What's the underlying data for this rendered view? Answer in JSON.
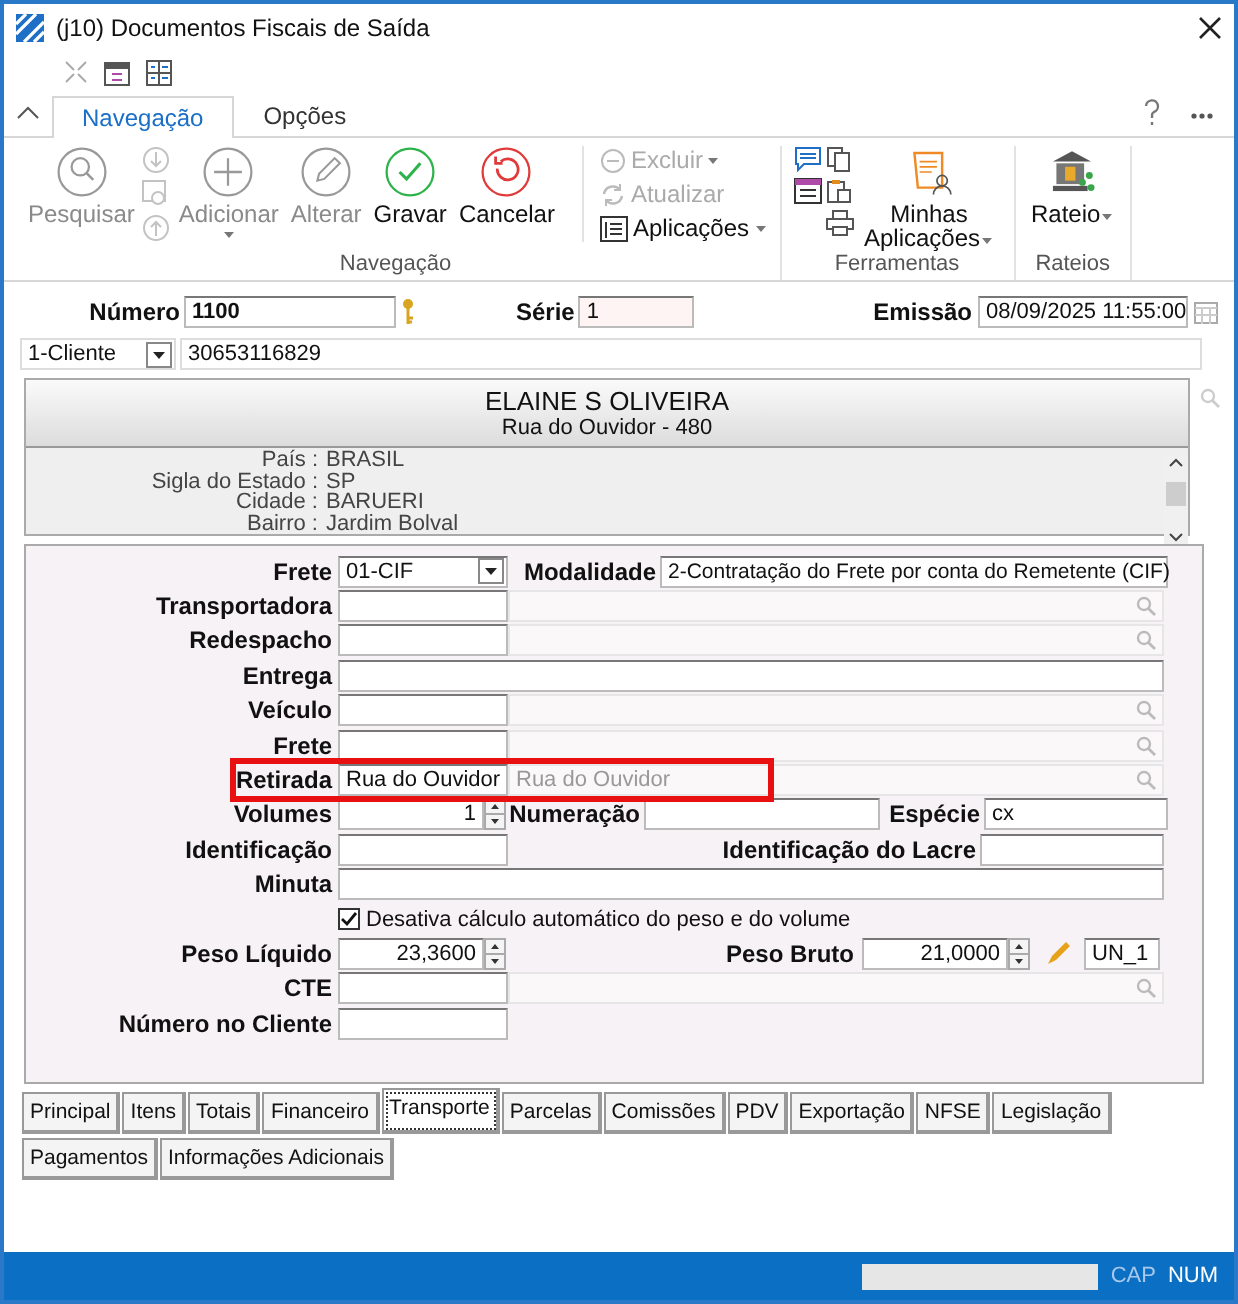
{
  "window": {
    "title": "(j10)  Documentos Fiscais de Saída"
  },
  "ribbon": {
    "tabs": [
      {
        "label": "Navegação",
        "selected": true
      },
      {
        "label": "Opções",
        "selected": false
      }
    ],
    "groups": [
      {
        "label": "Navegação",
        "buttons": [
          {
            "label": "Pesquisar",
            "disabled": true
          },
          {
            "label": "Adicionar",
            "disabled": true
          },
          {
            "label": "Alterar",
            "disabled": true
          },
          {
            "label": "Gravar",
            "disabled": false
          },
          {
            "label": "Cancelar",
            "disabled": false
          }
        ],
        "menu": [
          {
            "label": "Excluir",
            "disabled": true
          },
          {
            "label": "Atualizar",
            "disabled": true
          },
          {
            "label": "Aplicações",
            "disabled": false
          }
        ]
      },
      {
        "label": "Ferramentas",
        "buttons": [
          {
            "label": "Minhas Aplicações",
            "disabled": false
          }
        ]
      },
      {
        "label": "Rateios",
        "buttons": [
          {
            "label": "Rateio",
            "disabled": false
          }
        ]
      }
    ]
  },
  "header": {
    "numero": {
      "label": "Número",
      "value": "1100"
    },
    "serie": {
      "label": "Série",
      "value": "1"
    },
    "emissao": {
      "label": "Emissão",
      "value": "08/09/2025 11:55:00"
    },
    "tipo": "1-Cliente",
    "codigo": "30653116829"
  },
  "cliente": {
    "name": "ELAINE S OLIVEIRA",
    "address": "Rua do Ouvidor - 480",
    "details": [
      {
        "label": "País :",
        "value": "BRASIL"
      },
      {
        "label": "Sigla do Estado :",
        "value": "SP"
      },
      {
        "label": "Cidade :",
        "value": "BARUERI"
      },
      {
        "label": "Bairro :",
        "value": "Jardim Bolval"
      }
    ]
  },
  "transporte": {
    "frete": {
      "label": "Frete",
      "value": "01-CIF"
    },
    "modalidade": {
      "label": "Modalidade",
      "value": "2-Contratação do Frete por conta do Remetente (CIF)"
    },
    "transportadora": {
      "label": "Transportadora"
    },
    "redespacho": {
      "label": "Redespacho"
    },
    "entrega": {
      "label": "Entrega"
    },
    "veiculo": {
      "label": "Veículo"
    },
    "frete_lookup": {
      "label": "Frete"
    },
    "retirada": {
      "label": "Retirada",
      "value": "Rua do Ouvidor",
      "description": "Rua do Ouvidor",
      "highlighted": true
    },
    "volumes": {
      "label": "Volumes",
      "value": "1"
    },
    "numeracao": {
      "label": "Numeração"
    },
    "especie": {
      "label": "Espécie",
      "value": "cx"
    },
    "identificacao": {
      "label": "Identificação"
    },
    "identificacao_lacre": {
      "label": "Identificação do Lacre"
    },
    "minuta": {
      "label": "Minuta"
    },
    "desativa_calculo": {
      "label": "Desativa cálculo automático do peso e do volume",
      "checked": true
    },
    "peso_liquido": {
      "label": "Peso Líquido",
      "value": "23,3600"
    },
    "peso_bruto": {
      "label": "Peso Bruto",
      "value": "21,0000"
    },
    "unidade": "UN_1",
    "cte": {
      "label": "CTE"
    },
    "numero_cliente": {
      "label": "Número no Cliente"
    }
  },
  "tabs": [
    {
      "label": "Principal",
      "selected": false
    },
    {
      "label": "Itens",
      "selected": false
    },
    {
      "label": "Totais",
      "selected": false
    },
    {
      "label": "Financeiro",
      "selected": false
    },
    {
      "label": "Transporte",
      "selected": true
    },
    {
      "label": "Parcelas",
      "selected": false
    },
    {
      "label": "Comissões",
      "selected": false
    },
    {
      "label": "PDV",
      "selected": false
    },
    {
      "label": "Exportação",
      "selected": false
    },
    {
      "label": "NFSE",
      "selected": false
    },
    {
      "label": "Legislação",
      "selected": false
    },
    {
      "label": "Pagamentos",
      "selected": false
    },
    {
      "label": "Informações Adicionais",
      "selected": false
    }
  ],
  "status_bar": [
    {
      "label": "CAP",
      "on": false
    },
    {
      "label": "NUM",
      "on": true
    }
  ]
}
